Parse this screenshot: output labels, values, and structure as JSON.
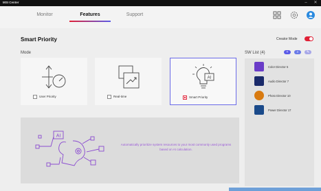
{
  "window": {
    "title": "MSI Center",
    "minimize": "–",
    "close": "✕"
  },
  "tabs": [
    {
      "label": "Monitor"
    },
    {
      "label": "Features",
      "active": true
    },
    {
      "label": "Support"
    }
  ],
  "header_icons": [
    "grid-icon",
    "settings-icon",
    "user-icon"
  ],
  "page": {
    "title": "Smart Priority",
    "creator_mode_label": "Creator Mode",
    "creator_mode_on": true,
    "mode_label": "Mode"
  },
  "modes": [
    {
      "label": "User Priority",
      "checked": false,
      "icon": "priority-gauge-icon"
    },
    {
      "label": "Real-time",
      "checked": false,
      "icon": "realtime-chart-icon"
    },
    {
      "label": "Smart Priority",
      "checked": true,
      "icon": "ai-lightbulb-icon"
    }
  ],
  "banner": {
    "text": "Automatically prioritize system resources to your most commonly used programs based on AI calculation."
  },
  "sw_list": {
    "title": "SW List (4)",
    "items": [
      {
        "name": "Color Director 5",
        "color": "#6a3cc8"
      },
      {
        "name": "Audio Director 7",
        "color": "#1a2a6a"
      },
      {
        "name": "Photo Director 10",
        "color": "#d87a10"
      },
      {
        "name": "Power Director 17",
        "color": "#1a4a8a"
      }
    ]
  },
  "colors": {
    "accent": "#e02036",
    "selected_border": "#6a6ae8",
    "banner_text": "#9b5ad8"
  }
}
